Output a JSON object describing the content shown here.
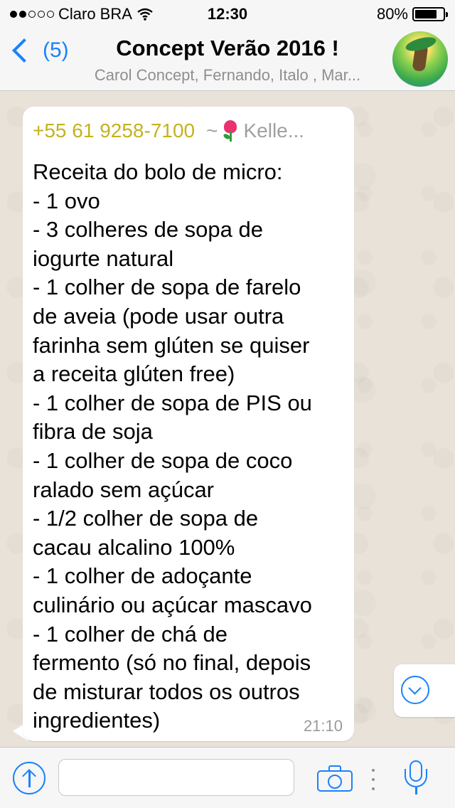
{
  "status_bar": {
    "carrier": "Claro BRA",
    "time": "12:30",
    "battery": "80%",
    "battery_level": 0.8,
    "signal_bars_filled": 2,
    "signal_bars_total": 5
  },
  "nav": {
    "unread_count": "(5)",
    "title": "Concept Verão 2016 !",
    "subtitle": "Carol Concept, Fernando, Italo , Mar..."
  },
  "message": {
    "sender_phone": "+55 61 9258-7100",
    "sender_name": "~🌷 Kelle...",
    "sender_name_text": "Kelle...",
    "sender_prefix": "~",
    "text": "Receita do bolo de micro:\n- 1 ovo\n- 3 colheres de sopa de\niogurte natural\n- 1 colher de sopa de farelo\nde aveia (pode usar outra\nfarinha sem glúten se quiser\na receita glúten free)\n- 1 colher de sopa de PIS ou\nfibra de soja\n- 1 colher de sopa de coco\nralado sem açúcar\n- 1/2 colher de sopa de\ncacau alcalino 100%\n- 1 colher de adoçante\nculinário ou açúcar mascavo\n- 1 colher de chá de\nfermento (só no final, depois\nde misturar todos os outros\ningredientes)",
    "time": "21:10"
  },
  "input": {
    "placeholder": "",
    "value": ""
  },
  "colors": {
    "accent": "#1a82fb",
    "sender_phone": "#c4b21f",
    "chat_background": "#e9e2d9"
  },
  "icons": [
    "back-chevron-icon",
    "group-avatar",
    "tulip-emoji-icon",
    "scroll-down-icon",
    "upload-icon",
    "camera-icon",
    "more-dots-icon",
    "microphone-icon"
  ]
}
